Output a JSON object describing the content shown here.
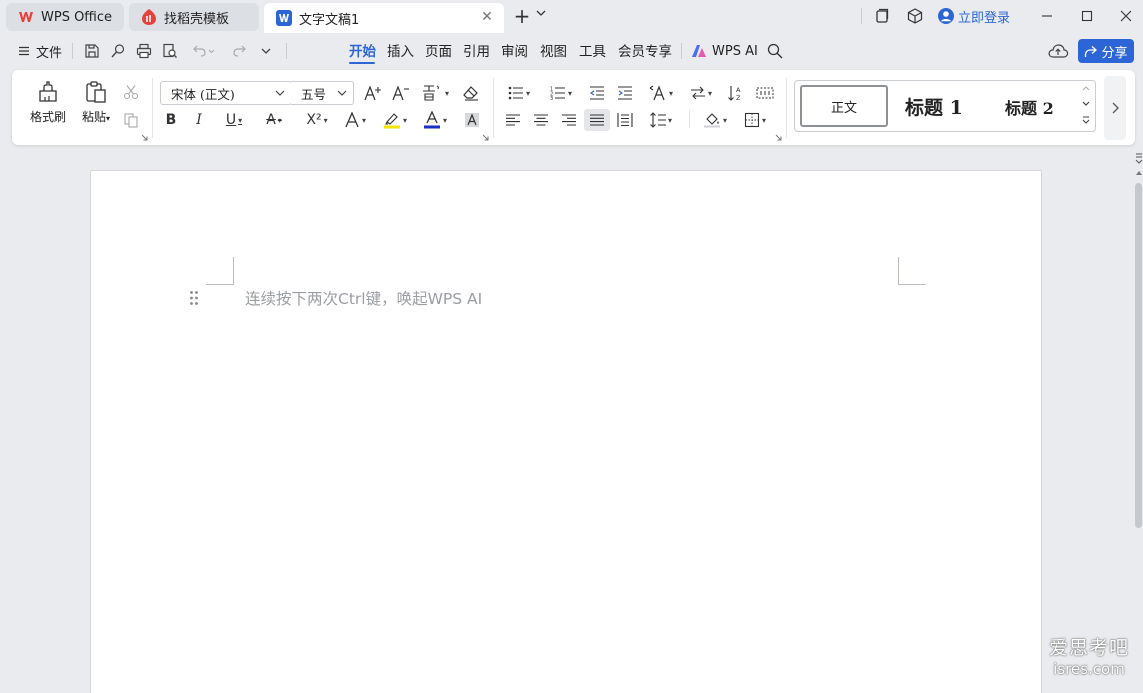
{
  "titlebar": {
    "tabs": [
      {
        "label": "WPS Office",
        "icon": "wps-logo-icon"
      },
      {
        "label": "找稻壳模板",
        "icon": "docer-logo-icon"
      },
      {
        "label": "文字文稿1",
        "icon": "writer-doc-icon",
        "active": true
      }
    ],
    "login_label": "立即登录"
  },
  "menubar": {
    "file_label": "文件",
    "tabs": [
      "开始",
      "插入",
      "页面",
      "引用",
      "审阅",
      "视图",
      "工具",
      "会员专享"
    ],
    "active_tab": "开始",
    "ai_label": "WPS AI",
    "share_label": "分享"
  },
  "ribbon": {
    "format_painter_label": "格式刷",
    "paste_label": "粘贴",
    "font_name": "宋体 (正文)",
    "font_size": "五号",
    "styles": {
      "normal": "正文",
      "heading1": "标题 1",
      "heading2": "标题 2"
    }
  },
  "document": {
    "placeholder": "连续按下两次Ctrl键，唤起WPS AI"
  },
  "watermark": {
    "line1": "爱思考吧",
    "line2": "isres.com"
  },
  "colors": {
    "accent": "#2c66d6",
    "wps_red": "#e8403b",
    "highlight_yellow": "#f5e400",
    "font_color_blue": "#1a2fc9"
  }
}
